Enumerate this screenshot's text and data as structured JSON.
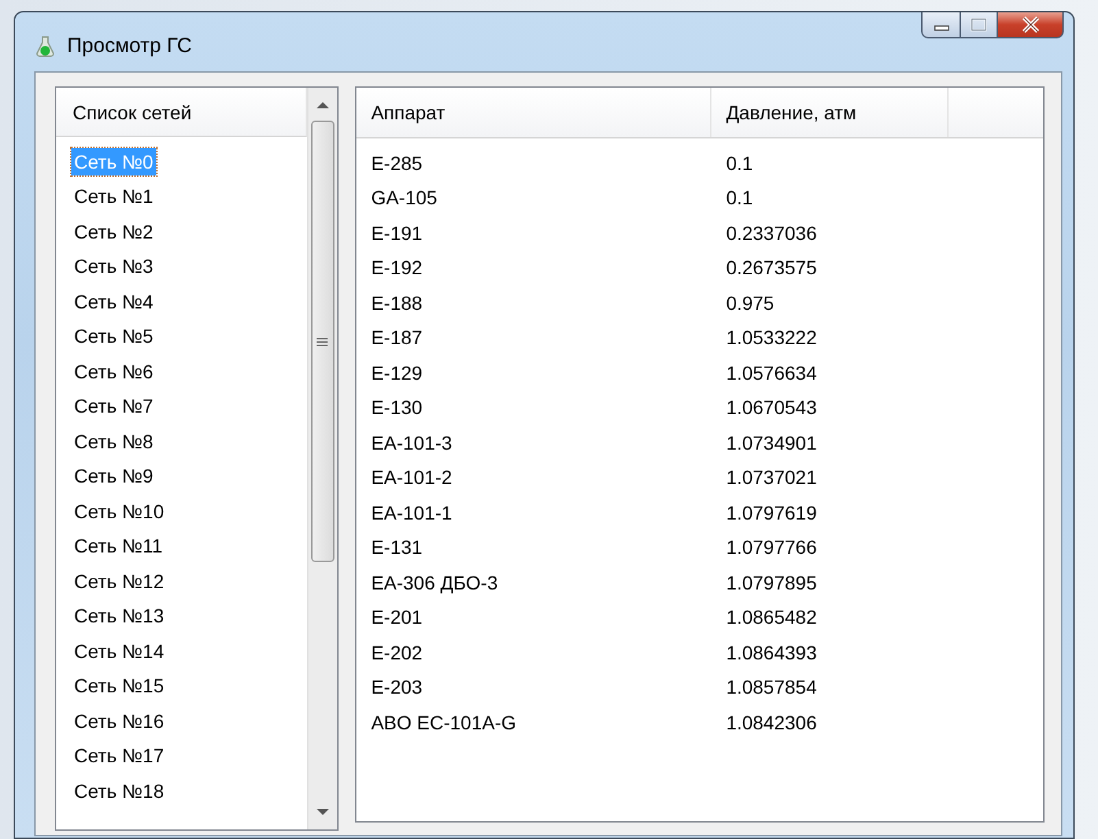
{
  "window": {
    "title": "Просмотр ГС"
  },
  "networks": {
    "header": "Список сетей",
    "items": [
      {
        "label": "Сеть №0",
        "selected": true
      },
      {
        "label": "Сеть №1",
        "selected": false
      },
      {
        "label": "Сеть №2",
        "selected": false
      },
      {
        "label": "Сеть №3",
        "selected": false
      },
      {
        "label": "Сеть №4",
        "selected": false
      },
      {
        "label": "Сеть №5",
        "selected": false
      },
      {
        "label": "Сеть №6",
        "selected": false
      },
      {
        "label": "Сеть №7",
        "selected": false
      },
      {
        "label": "Сеть №8",
        "selected": false
      },
      {
        "label": "Сеть №9",
        "selected": false
      },
      {
        "label": "Сеть №10",
        "selected": false
      },
      {
        "label": "Сеть №11",
        "selected": false
      },
      {
        "label": "Сеть №12",
        "selected": false
      },
      {
        "label": "Сеть №13",
        "selected": false
      },
      {
        "label": "Сеть №14",
        "selected": false
      },
      {
        "label": "Сеть №15",
        "selected": false
      },
      {
        "label": "Сеть №16",
        "selected": false
      },
      {
        "label": "Сеть №17",
        "selected": false
      },
      {
        "label": "Сеть №18",
        "selected": false
      }
    ]
  },
  "table": {
    "columns": [
      "Аппарат",
      "Давление, атм"
    ],
    "rows": [
      [
        "E-285",
        "0.1"
      ],
      [
        "GA-105",
        "0.1"
      ],
      [
        "E-191",
        "0.2337036"
      ],
      [
        "E-192",
        "0.2673575"
      ],
      [
        "E-188",
        "0.975"
      ],
      [
        "E-187",
        "1.0533222"
      ],
      [
        "E-129",
        "1.0576634"
      ],
      [
        "E-130",
        "1.0670543"
      ],
      [
        "EA-101-3",
        "1.0734901"
      ],
      [
        "EA-101-2",
        "1.0737021"
      ],
      [
        "EA-101-1",
        "1.0797619"
      ],
      [
        "E-131",
        "1.0797766"
      ],
      [
        "EA-306 ДБО-3",
        "1.0797895"
      ],
      [
        "E-201",
        "1.0865482"
      ],
      [
        "E-202",
        "1.0864393"
      ],
      [
        "E-203",
        "1.0857854"
      ],
      [
        "ABO EC-101A-G",
        "1.0842306"
      ]
    ]
  }
}
